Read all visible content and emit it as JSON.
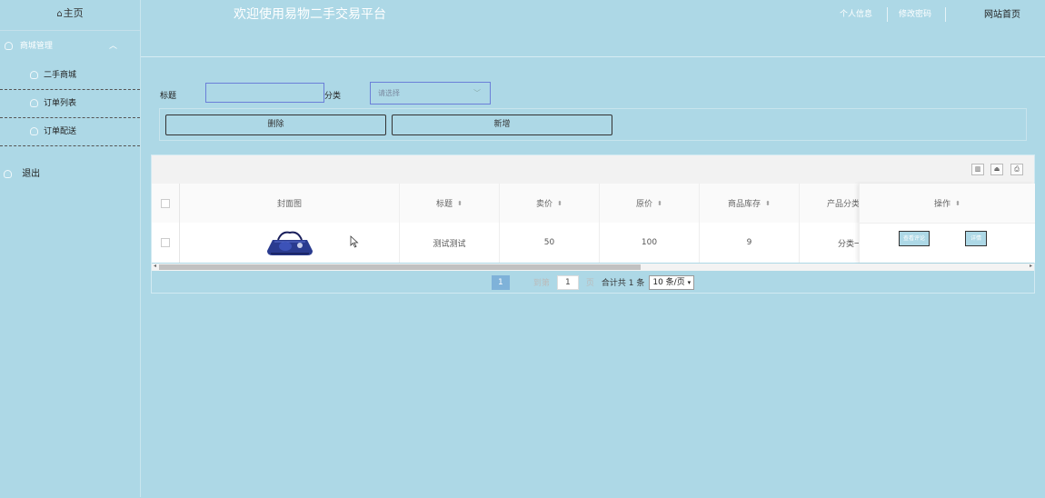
{
  "sidebar": {
    "home": "主页",
    "group": "商城管理",
    "items": [
      {
        "label": "二手商城"
      },
      {
        "label": "订单列表"
      },
      {
        "label": "订单配送"
      }
    ],
    "logout": "退出"
  },
  "header": {
    "welcome": "欢迎使用易物二手交易平台",
    "nav": [
      "个人信息",
      "修改密码",
      "网站首页"
    ]
  },
  "search": {
    "title_label": "标题",
    "title_value": "",
    "category_label": "分类",
    "category_placeholder": "请选择"
  },
  "actions": {
    "delete": "删除",
    "add": "新增"
  },
  "table": {
    "columns": [
      "封面图",
      "标题",
      "卖价",
      "原价",
      "商品库存",
      "产品分类",
      "操作"
    ],
    "rows": [
      {
        "cover": "handbag-image",
        "title": "测试测试",
        "price": "50",
        "original_price": "100",
        "stock": "9",
        "category": "分类一",
        "ops": [
          "查看评论",
          "详情"
        ]
      }
    ]
  },
  "pager": {
    "current": "1",
    "goto_label": "到第",
    "goto_value": "1",
    "page_unit": "页",
    "total": "合计共 1 条",
    "page_size": "10 条/页"
  },
  "colors": {
    "background": "#add8e6",
    "page_active": "#7fb2d9",
    "input_border": "#6b7fd8"
  }
}
